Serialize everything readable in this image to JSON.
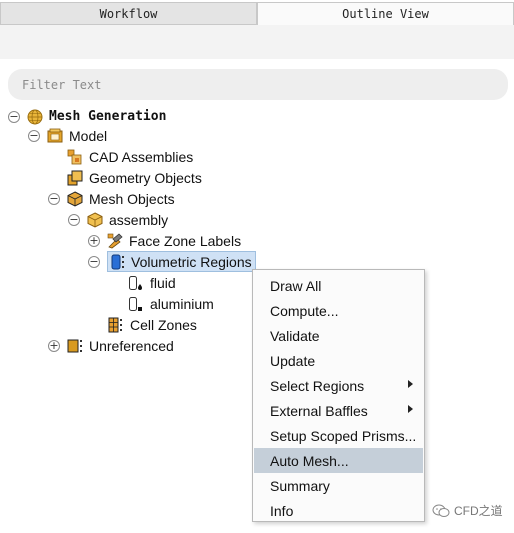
{
  "tabs": [
    {
      "label": "Workflow",
      "active": false
    },
    {
      "label": "Outline View",
      "active": true
    }
  ],
  "filter": {
    "placeholder": "Filter Text",
    "value": ""
  },
  "tree": {
    "mesh_generation": "Mesh Generation",
    "model": "Model",
    "cad_assemblies": "CAD Assemblies",
    "geometry_objects": "Geometry Objects",
    "mesh_objects": "Mesh Objects",
    "assembly": "assembly",
    "face_zone_labels": "Face Zone Labels",
    "volumetric_regions": "Volumetric Regions",
    "fluid": "fluid",
    "aluminium": "aluminium",
    "cell_zones": "Cell Zones",
    "unreferenced": "Unreferenced"
  },
  "context_menu": {
    "items": [
      {
        "label": "Draw All",
        "submenu": false
      },
      {
        "label": "Compute...",
        "submenu": false
      },
      {
        "label": "Validate",
        "submenu": false
      },
      {
        "label": "Update",
        "submenu": false
      },
      {
        "label": "Select Regions",
        "submenu": true
      },
      {
        "label": "External Baffles",
        "submenu": true
      },
      {
        "label": "Setup Scoped Prisms...",
        "submenu": false
      },
      {
        "label": "Auto Mesh...",
        "submenu": false,
        "highlighted": true
      },
      {
        "label": "Summary",
        "submenu": false
      },
      {
        "label": "Info",
        "submenu": false
      }
    ]
  },
  "watermark": {
    "text": "CFD之道"
  },
  "colors": {
    "selection": "#cfe1f5",
    "menu_highlight": "#c5cfd9",
    "accent_yellow": "#d9a21b",
    "accent_blue": "#2a6fd6"
  }
}
